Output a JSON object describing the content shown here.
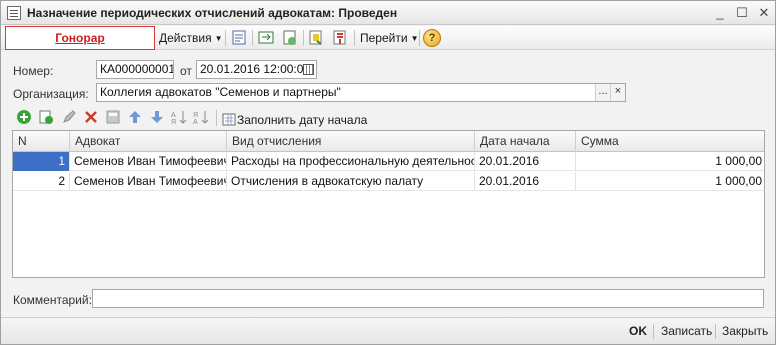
{
  "window": {
    "title": "Назначение периодических отчислений адвокатам: Проведен",
    "minimize_glyph": "_",
    "maximize_glyph": "☐",
    "close_glyph": "✕"
  },
  "toolbar": {
    "tab_label": "Гонорар",
    "actions_label": "Действия",
    "goto_label": "Перейти",
    "help_glyph": "?"
  },
  "form": {
    "number_label": "Номер:",
    "number_value": "КА000000001",
    "from_label": "от",
    "date_value": "20.01.2016 12:00:00",
    "org_label": "Организация:",
    "org_value": "Коллегия адвокатов \"Семенов и партнеры\"",
    "ellipsis": "...",
    "clear": "×",
    "comment_label": "Комментарий:",
    "comment_value": ""
  },
  "table_toolbar": {
    "fill_label": "Заполнить дату начала"
  },
  "table": {
    "columns": [
      "N",
      "Адвокат",
      "Вид отчисления",
      "Дата начала",
      "Сумма"
    ],
    "rows": [
      {
        "n": "1",
        "lawyer": "Семенов Иван Тимофеевич",
        "type": "Расходы на профессиональную деятельность",
        "start": "20.01.2016",
        "sum": "1 000,00"
      },
      {
        "n": "2",
        "lawyer": "Семенов Иван Тимофеевич",
        "type": "Отчисления в адвокатскую палату",
        "start": "20.01.2016",
        "sum": "1 000,00"
      }
    ]
  },
  "footer": {
    "ok_label": "OK",
    "save_label": "Записать",
    "close_label": "Закрыть"
  },
  "colors": {
    "accent_red": "#cc1f1f",
    "selection": "#3d6fc6"
  }
}
